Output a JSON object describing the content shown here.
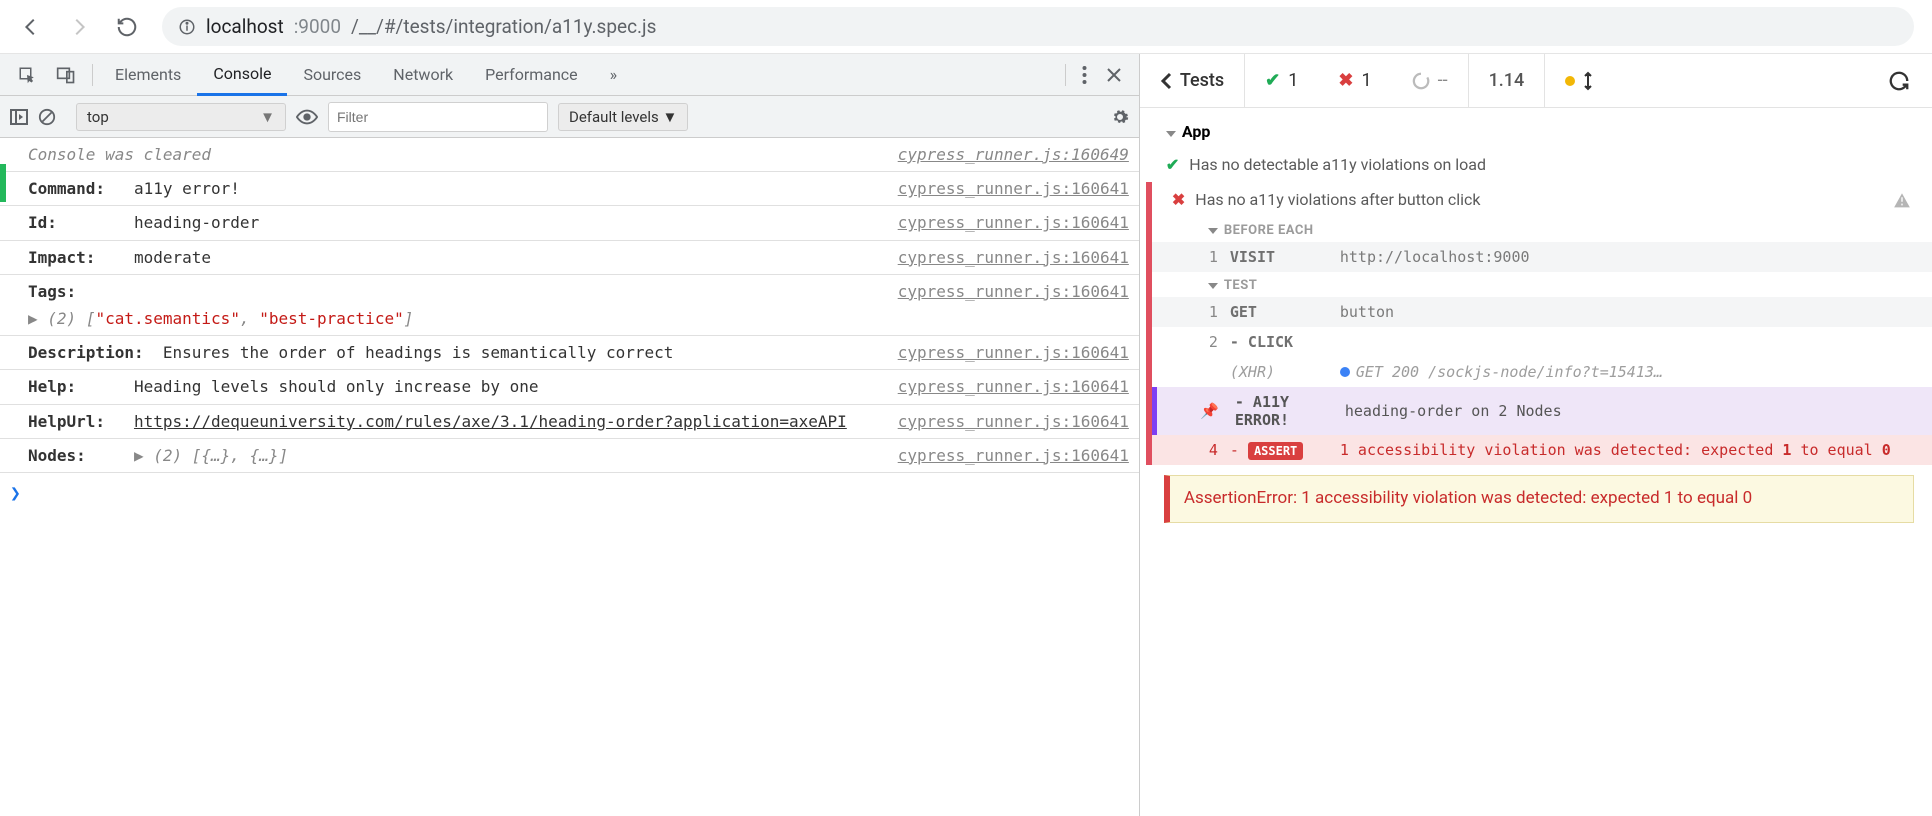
{
  "url": {
    "host": "localhost",
    "port": ":9000",
    "path": "/__/#/tests/integration/a11y.spec.js"
  },
  "devtools": {
    "tabs": [
      "Elements",
      "Console",
      "Sources",
      "Network",
      "Performance"
    ],
    "overflow": "»",
    "context": "top",
    "filter_placeholder": "Filter",
    "levels": "Default levels ▼"
  },
  "console": {
    "cleared": "Console was cleared",
    "src0": "cypress_runner.js:160649",
    "src": "cypress_runner.js:160641",
    "command_k": "Command:",
    "command_v": "a11y error!",
    "id_k": "Id:",
    "id_v": "heading-order",
    "impact_k": "Impact:",
    "impact_v": "moderate",
    "tags_k": "Tags:",
    "tags_len": "(2)",
    "tags_open": "[",
    "tags_a": "\"cat.semantics\"",
    "tags_comma": ", ",
    "tags_b": "\"best-practice\"",
    "tags_close": "]",
    "desc_k": "Description:",
    "desc_v": "Ensures the order of headings is semantically correct",
    "help_k": "Help:",
    "help_v": "Heading levels should only increase by one",
    "helpurl_k": "HelpUrl:",
    "helpurl_v": "https://dequeuniversity.com/rules/axe/3.1/heading-order?application=axeAPI",
    "nodes_k": "Nodes:",
    "nodes_v": "(2) [{…}, {…}]"
  },
  "cypress": {
    "back": "Tests",
    "pass": "1",
    "fail": "1",
    "pending": "--",
    "duration": "1.14",
    "suite": "App",
    "tests": [
      {
        "status": "pass",
        "title": "Has no detectable a11y violations on load"
      },
      {
        "status": "fail",
        "title": "Has no a11y violations after button click"
      }
    ],
    "sections": {
      "before": "BEFORE EACH",
      "test": "TEST"
    },
    "cmds": {
      "visit_idx": "1",
      "visit": "VISIT",
      "visit_msg": "http://localhost:9000",
      "get_idx": "1",
      "get": "GET",
      "get_msg": "button",
      "click_idx": "2",
      "click": "- CLICK",
      "xhr_label": "(XHR)",
      "xhr_msg": "GET 200 /sockjs-node/info?t=15413…",
      "a11y_name": "- A11Y ERROR!",
      "a11y_msg": "heading-order on 2 Nodes",
      "assert_idx": "4",
      "assert_dash": "- ",
      "assert_badge": "ASSERT",
      "assert_msg_a": "1 accessibility violation was detected: expected ",
      "assert_msg_b": "1",
      "assert_msg_c": " to equal ",
      "assert_msg_d": "0"
    },
    "error": "AssertionError: 1 accessibility violation was detected: expected 1 to equal 0"
  }
}
